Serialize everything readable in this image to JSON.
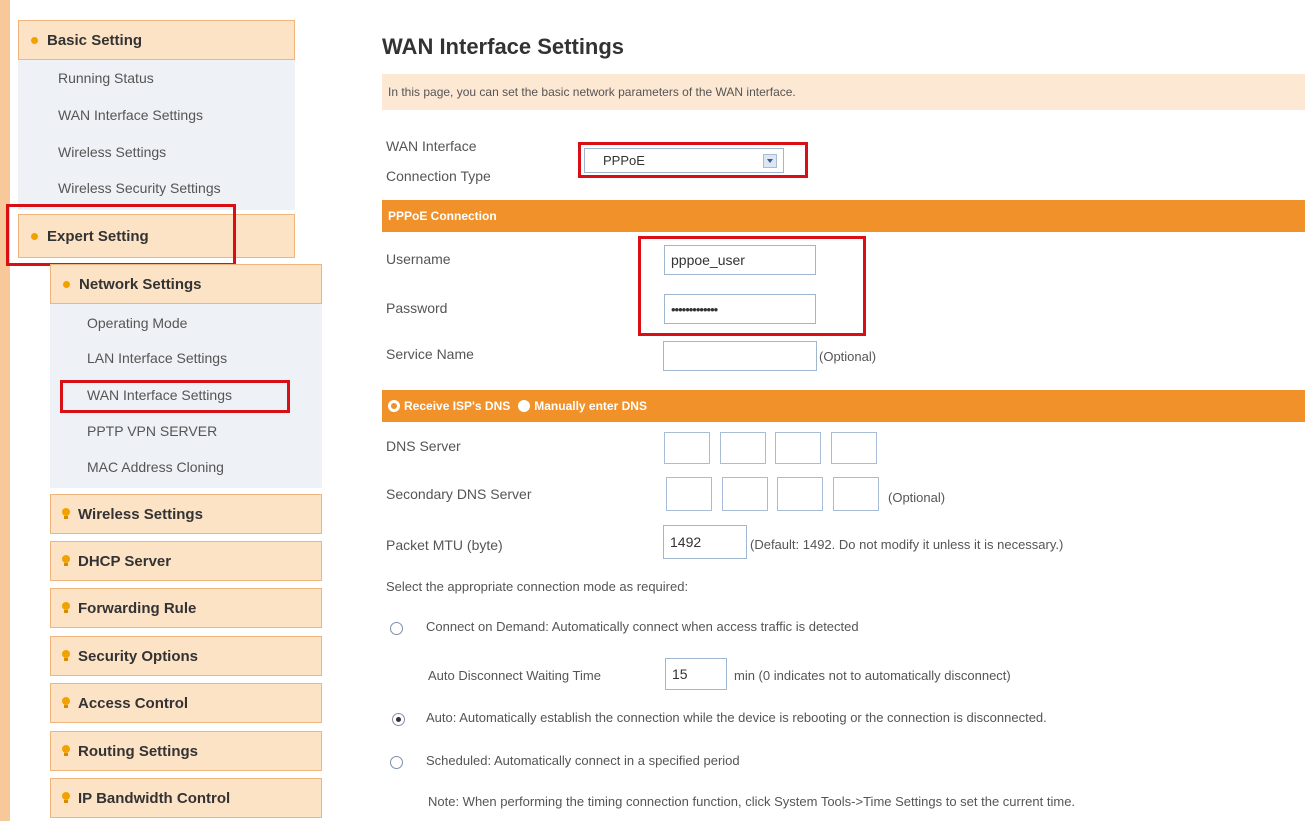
{
  "sidebar": {
    "basic_setting": "Basic Setting",
    "basic_items": [
      "Running Status",
      "WAN Interface Settings",
      "Wireless Settings",
      "Wireless Security Settings"
    ],
    "expert_setting": "Expert Setting",
    "network_settings": "Network Settings",
    "network_items": [
      "Operating Mode",
      "LAN Interface Settings",
      "WAN Interface Settings",
      "PPTP VPN SERVER",
      "MAC Address Cloning"
    ],
    "categories": [
      "Wireless Settings",
      "DHCP Server",
      "Forwarding Rule",
      "Security Options",
      "Access Control",
      "Routing Settings",
      "IP Bandwidth Control"
    ]
  },
  "main": {
    "title": "WAN Interface Settings",
    "description": "In this page, you can set the basic network parameters of the WAN interface.",
    "conn_type_label_1": "WAN Interface",
    "conn_type_label_2": "Connection Type",
    "conn_type_value": "PPPoE",
    "pppoe_header": "PPPoE Connection",
    "username_label": "Username",
    "username_value": "pppoe_user",
    "password_label": "Password",
    "password_mask": "•••••••••••••",
    "service_name_label": "Service Name",
    "optional": "(Optional)",
    "dns_receive": "Receive ISP's DNS",
    "dns_manual": "Manually enter DNS",
    "dns_server_label": "DNS Server",
    "secondary_dns_label": "Secondary DNS Server",
    "mtu_label": "Packet MTU (byte)",
    "mtu_value": "1492",
    "mtu_hint": "(Default: 1492. Do not modify it unless it is necessary.)",
    "select_mode": "Select the appropriate connection mode as required:",
    "mode_demand": "Connect on Demand: Automatically connect when access traffic is detected",
    "auto_disconnect_label": "Auto Disconnect Waiting Time",
    "auto_disconnect_value": "15",
    "auto_disconnect_hint": "min (0 indicates not to automatically disconnect)",
    "mode_auto": "Auto: Automatically establish the connection while the device is rebooting or the connection is disconnected.",
    "mode_scheduled": "Scheduled: Automatically connect in a specified period",
    "note": "Note: When performing the timing connection function, click System Tools->Time Settings to set the current time."
  },
  "colors": {
    "orange_bar": "#f1912a",
    "sidebar_bg": "#fde3c6",
    "highlight": "#d80f15"
  }
}
